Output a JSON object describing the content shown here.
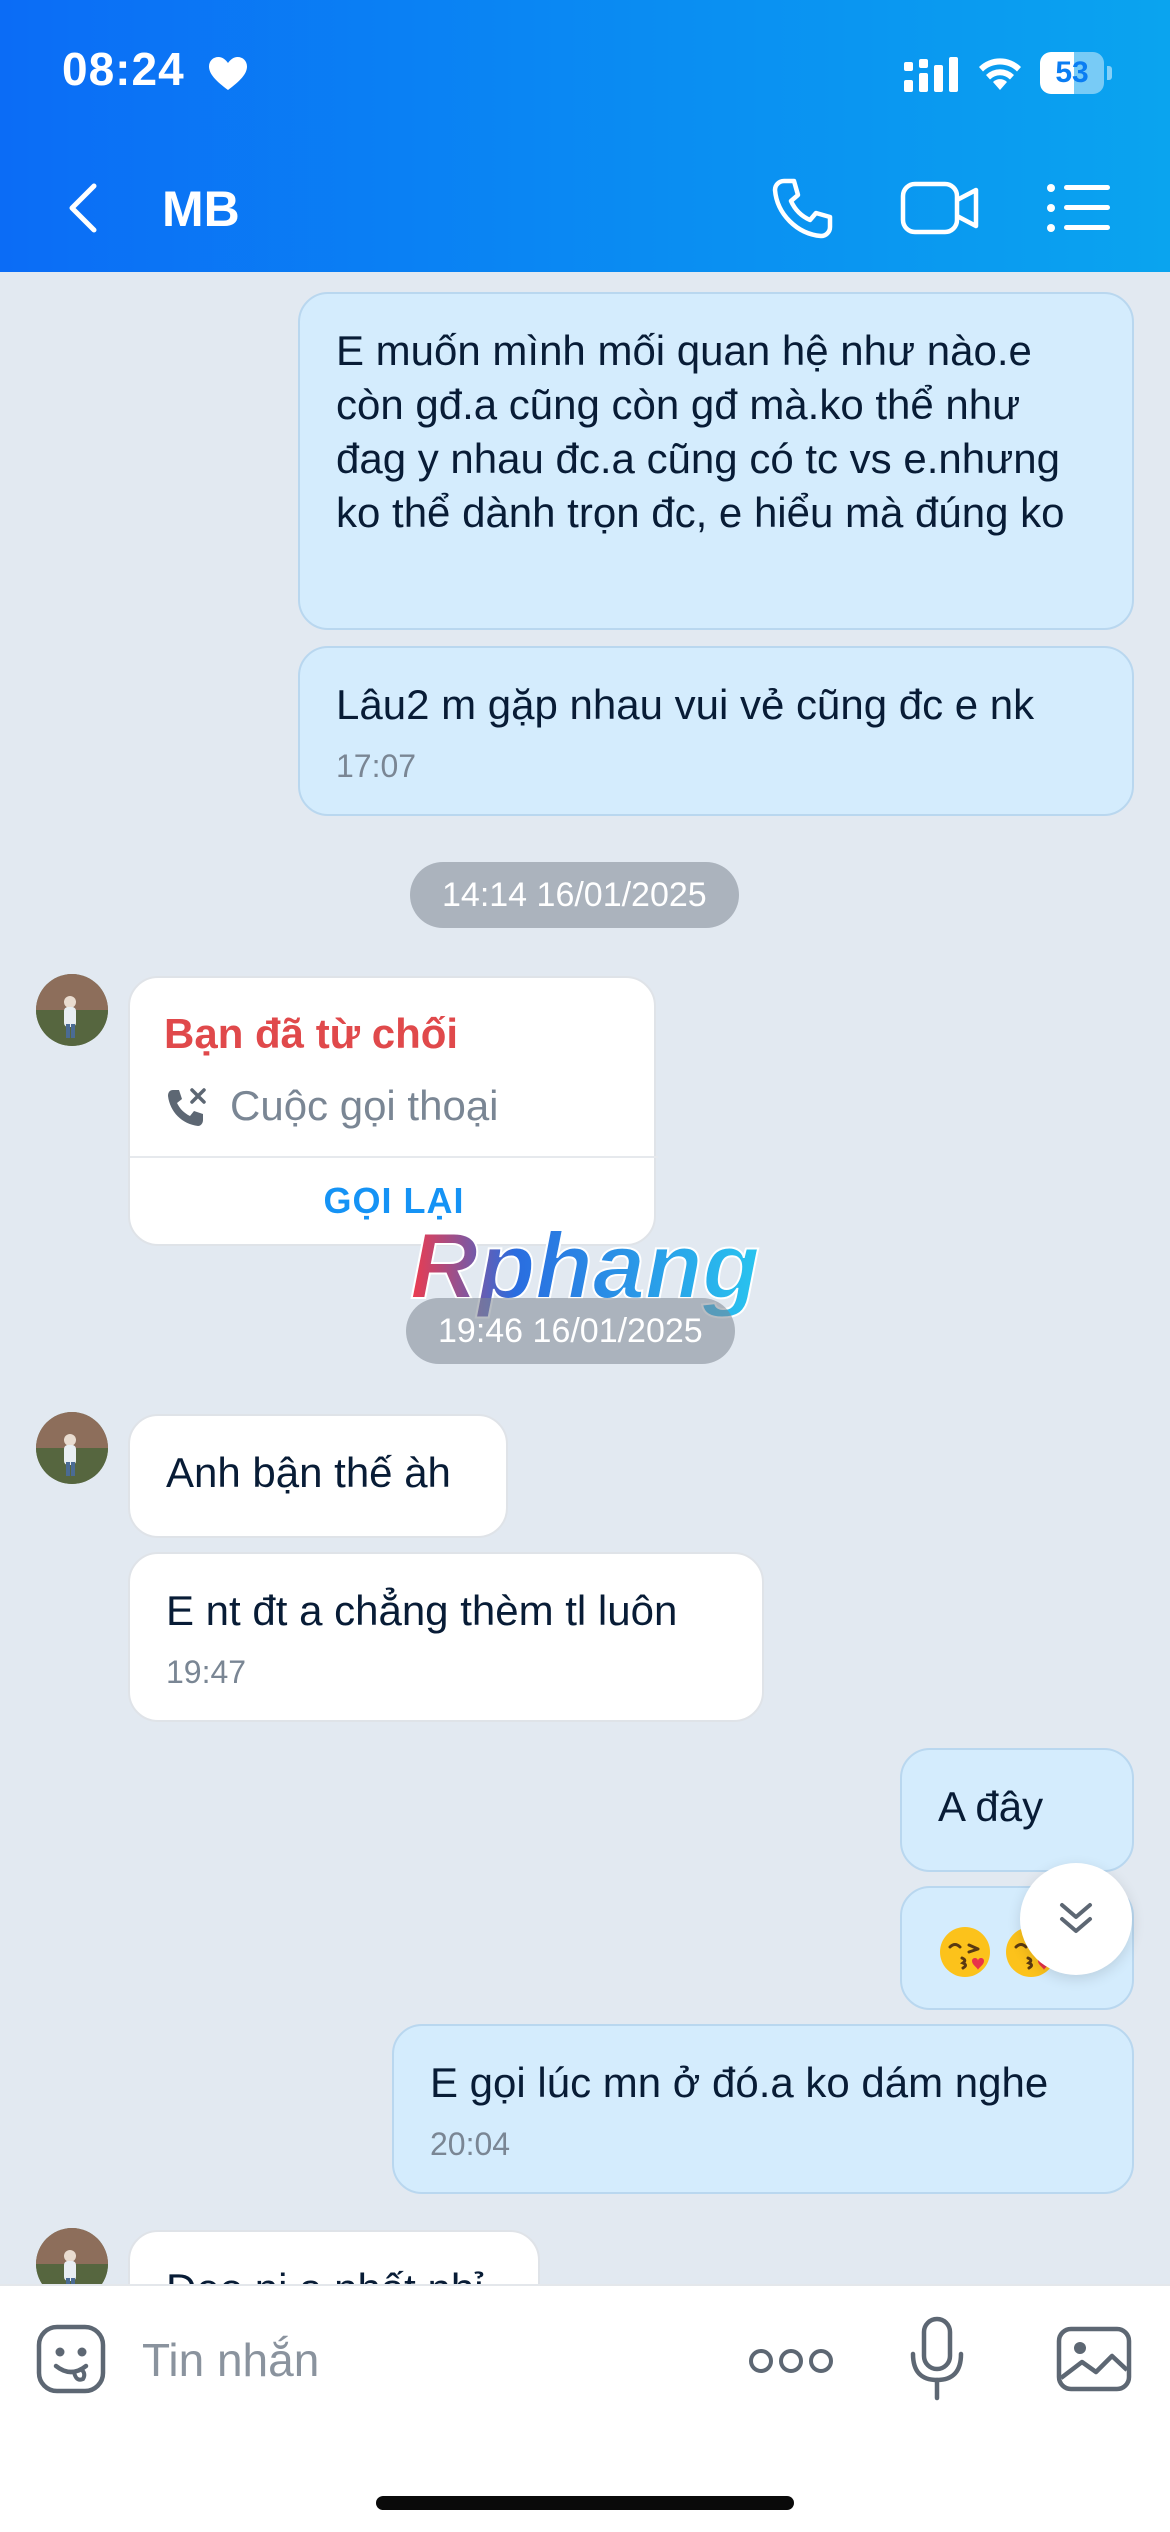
{
  "status_bar": {
    "time": "08:24",
    "battery": "53",
    "battery_level": 0.53
  },
  "header": {
    "contact_name": "MB"
  },
  "messages": {
    "out_1": {
      "text": "E muốn mình mối quan hệ như nào.e còn gđ.a cũng còn gđ mà.ko thể như đag y nhau đc.a cũng có tc vs e.nhưng ko thể dành trọn đc, e hiểu mà đúng ko"
    },
    "out_2": {
      "text": "Lâu2 m gặp nhau vui vẻ cũng đc e nk",
      "time": "17:07"
    },
    "date_1": "14:14 16/01/2025",
    "call_card": {
      "title": "Bạn đã từ chối",
      "subtitle": "Cuộc gọi thoại",
      "action": "GỌI LẠI"
    },
    "date_2": "19:46 16/01/2025",
    "in_1": {
      "text": "Anh bận thế àh"
    },
    "in_2": {
      "text": "E nt đt a chẳng thèm tl luôn",
      "time": "19:47"
    },
    "out_3": {
      "text": "A đây"
    },
    "out_5": {
      "text": "E gọi lúc mn ở đó.a ko dám nghe",
      "time": "20:04"
    },
    "in_3": {
      "text": "Đeo ni a nhất nhỉ"
    }
  },
  "watermark": {
    "text": "Rphang"
  },
  "input_bar": {
    "placeholder": "Tin nhắn"
  },
  "colors": {
    "header_start": "#0b6cf6",
    "header_end": "#0aa4ef",
    "outgoing_bubble": "#d4ecfd",
    "incoming_bubble": "#ffffff",
    "chat_background": "#e2e9f1",
    "declined_red": "#e0494b",
    "action_blue": "#1593f5"
  },
  "icons": [
    "heart-icon",
    "signal-icon",
    "wifi-icon",
    "back-icon",
    "phone-icon",
    "video-icon",
    "list-icon",
    "declined-call-icon",
    "kiss-emoji-icon",
    "chevron-double-down-icon",
    "sticker-icon",
    "more-icon",
    "mic-icon",
    "image-icon"
  ]
}
